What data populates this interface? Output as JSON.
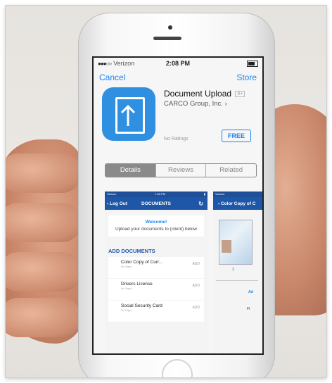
{
  "status": {
    "carrier": "Verizon",
    "time": "2:08 PM"
  },
  "nav": {
    "cancel": "Cancel",
    "store": "Store"
  },
  "app": {
    "name": "Document Upload",
    "age_rating": "4+",
    "developer": "CARCO Group, Inc.",
    "ratings": "No Ratings",
    "price_button": "FREE"
  },
  "tabs": [
    "Details",
    "Reviews",
    "Related"
  ],
  "screenshot1": {
    "carrier": "Verizon",
    "time": "1:53 PM",
    "back": "‹ Log Out",
    "title": "DOCUMENTS",
    "welcome": "Welcome!",
    "welcome_sub": "Upload your documents to (client) below",
    "section": "ADD DOCUMENTS",
    "documents": [
      {
        "label": "Color Copy of Curr...",
        "pages": "No Pages",
        "action": "ADD"
      },
      {
        "label": "Drivers License",
        "pages": "No Pages",
        "action": "ADD"
      },
      {
        "label": "Social Security Card",
        "pages": "No Pages",
        "action": "ADD"
      }
    ]
  },
  "screenshot2": {
    "carrier": "Verizon",
    "title": "‹ Color Copy of C",
    "number": "1",
    "link1": "Ad",
    "link2": "Fi"
  },
  "colors": {
    "ios_blue": "#1a82f0",
    "app_icon_blue": "#2f8fe0",
    "nav_blue": "#1f57a8"
  }
}
